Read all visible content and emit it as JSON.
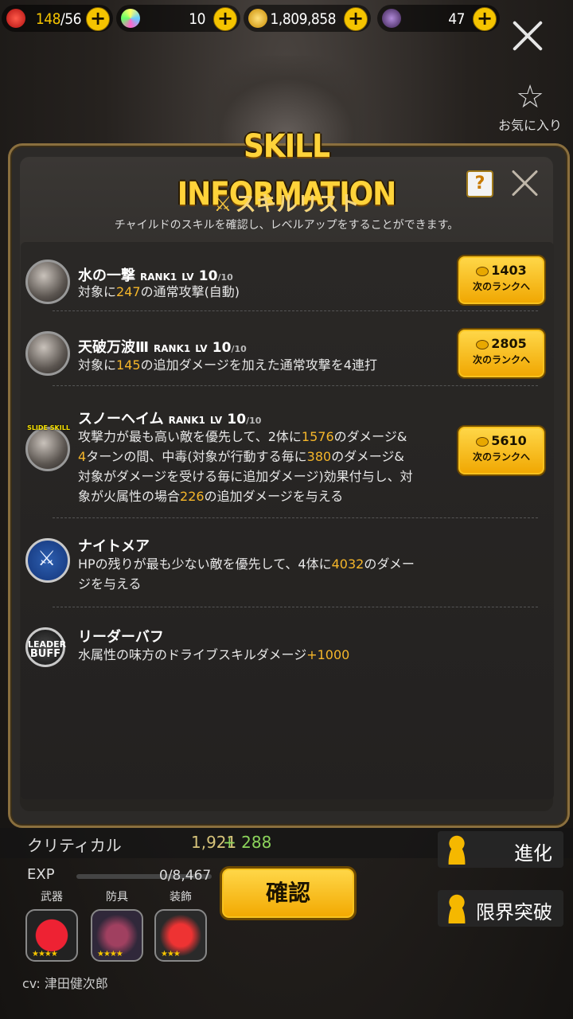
{
  "topbar": {
    "stamina": {
      "current": "148",
      "max": "/56"
    },
    "gems": "10",
    "gold": "1,809,858",
    "crystals": "47"
  },
  "favorite_label": "お気に入り",
  "dialog": {
    "title": "SKILL INFORMATION",
    "heading": "スキルリスト",
    "subtitle": "チャイルドのスキルを確認し、レベルアップをすることができます。",
    "help": "?"
  },
  "skills": [
    {
      "name": "水の一撃",
      "rank": "RANK1",
      "lv_prefix": "LV",
      "lv": "10",
      "lv_max": "/10",
      "desc_parts": [
        "対象に",
        "247",
        "の通常攻撃(自動)"
      ],
      "cost": "1403",
      "button_caption": "次のランクへ"
    },
    {
      "name": "天破万波Ⅲ",
      "rank": "RANK1",
      "lv_prefix": "LV",
      "lv": "10",
      "lv_max": "/10",
      "desc_parts": [
        "対象に",
        "145",
        "の追加ダメージを加えた通常攻撃を4連打"
      ],
      "cost": "2805",
      "button_caption": "次のランクへ"
    },
    {
      "name": "スノーヘイム",
      "rank": "RANK1",
      "lv_prefix": "LV",
      "lv": "10",
      "lv_max": "/10",
      "badge": "SLIDE SKILL",
      "desc_lines": [
        [
          "攻撃力が最も高い敵を優先して、2体に",
          "1576",
          "のダメージ&"
        ],
        [
          "4",
          "ターンの間、中毒(対象が行動する毎に",
          "380",
          "のダメージ&"
        ],
        [
          "対象がダメージを受ける毎に追加ダメージ)効果付与し、対"
        ],
        [
          "象が火属性の場合",
          "226",
          "の追加ダメージを与える"
        ]
      ],
      "cost": "5610",
      "button_caption": "次のランクへ"
    },
    {
      "name": "ナイトメア",
      "desc_lines": [
        [
          "HPの残りが最も少ない敵を優先して、4体に",
          "4032",
          "のダメー"
        ],
        [
          "ジを与える"
        ]
      ]
    },
    {
      "name": "リーダーバフ",
      "icon_text": [
        "LEADER",
        "BUFF"
      ],
      "desc_parts": [
        "水属性の味方のドライブスキルダメージ",
        "+1000"
      ]
    }
  ],
  "background": {
    "critical_label": "クリティカル",
    "critical_value": "1,921",
    "critical_bonus": "+ 288",
    "exp_label": "EXP",
    "exp_value": "0/8,467",
    "equip": [
      {
        "label": "武器",
        "stars": "★★★★"
      },
      {
        "label": "防具",
        "stars": "★★★★"
      },
      {
        "label": "装飾",
        "stars": "★★★"
      }
    ],
    "confirm": "確認",
    "evolve": "進化",
    "limit_break": "限界突破",
    "cv": "cv: 津田健次郎"
  },
  "colors": {
    "accent": "#f5b62a",
    "button": "#f5c400"
  }
}
